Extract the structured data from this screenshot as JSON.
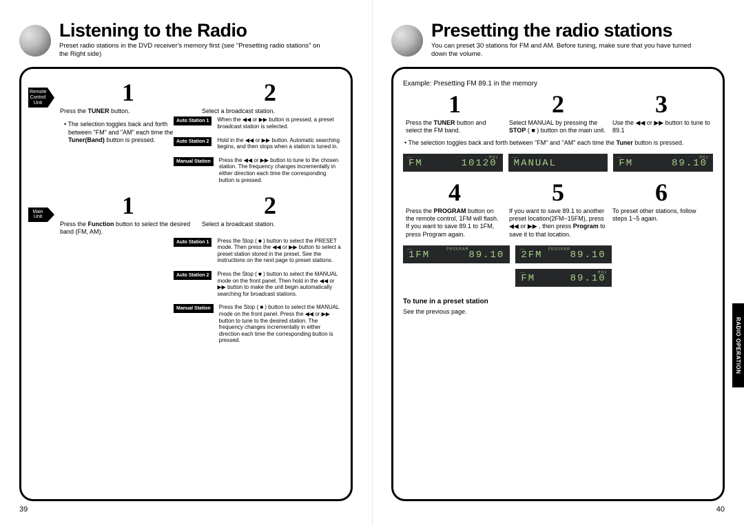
{
  "left": {
    "title": "Listening to the Radio",
    "intro": "Preset radio stations in the DVD receiver's memory first (see \"Presetting radio stations\" on the Right side)",
    "remoteLabel": "Remote Control Unit",
    "mainLabel": "Main Unit",
    "remote": {
      "step1_num": "1",
      "step1_text_a": "Press the ",
      "step1_text_b": "TUNER",
      "step1_text_c": " button.",
      "step2_num": "2",
      "step2_text": "Select a broadcast station.",
      "bullet_a": "• The selection toggles back and forth between \"FM\" and \"AM\" each time the ",
      "bullet_b": "Tuner(Band)",
      "bullet_c": " button is pressed.",
      "rows": [
        {
          "pill": "Auto Station 1",
          "text": "When the ◀◀ or ▶▶ button is pressed, a preset broadcast station is selected."
        },
        {
          "pill": "Auto Station 2",
          "text": "Hold in the ◀◀ or ▶▶ button. Automatic searching begins, and then stops when a station is tuned in."
        },
        {
          "pill": "Manual Station",
          "text": "Press the ◀◀ or ▶▶ button to tune to the chosen station. The frequency changes incrementally in either direction each time the corresponding button is pressed."
        }
      ]
    },
    "main": {
      "step1_num": "1",
      "step1_text_a": "Press the ",
      "step1_text_b": "Function",
      "step1_text_c": " button to select the desired band (FM, AM).",
      "step2_num": "2",
      "step2_text": "Select a broadcast station.",
      "rows": [
        {
          "pill": "Auto Station 1",
          "text": "Press the Stop ( ■ ) button to select the PRESET mode. Then press the ◀◀ or ▶▶ button to select a preset station stored in the preset. See the instructions on the next page to preset stations."
        },
        {
          "pill": "Auto Station 2",
          "text": "Press the Stop ( ■ ) button to select the MANUAL mode on the front panel. Then hold in the ◀◀ or ▶▶ button to make the unit begin automatically searching for broadcast stations."
        },
        {
          "pill": "Manual Station",
          "text": "Press the Stop ( ■ ) button to select the MANUAL mode on the front panel. Press the ◀◀ or ▶▶ button to tune to the desired station. The frequency changes incrementally in either direction each time the corresponding button is pressed."
        }
      ]
    },
    "pageNum": "39"
  },
  "right": {
    "title": "Presetting the radio stations",
    "intro": "You can preset 30 stations for FM and AM. Before tuning, make sure that you have turned down the volume.",
    "example": "Example: Presetting FM 89.1 in the memory",
    "steps": {
      "s1": {
        "num": "1",
        "a": "Press the ",
        "b": "TUNER",
        "c": " button and select the FM band."
      },
      "s2": {
        "num": "2",
        "a": "Select MANUAL by pressing the ",
        "b": "STOP",
        "c": " ( ■ ) button on the main unit."
      },
      "s3": {
        "num": "3",
        "a": "Use the ◀◀ or ▶▶ button to tune to 89.1"
      },
      "s4": {
        "num": "4",
        "a": "Press the ",
        "b": "PROGRAM",
        "c": " button on the remote control, 1FM will flash. If you want to save 89.1 to 1FM, press Program again."
      },
      "s5": {
        "num": "5",
        "a": "If you want to save 89.1 to another preset location(2FM~15FM), press ◀◀ or ▶▶ , then press ",
        "b": "Program",
        "c": " to save it to that location."
      },
      "s6": {
        "num": "6",
        "a": "To preset other stations, follow steps 1~5 again."
      }
    },
    "bullet_a": "• The selection toggles back and forth between \"FM\" and \"AM\" each time the ",
    "bullet_b": "Tuner",
    "bullet_c": " button is pressed.",
    "displays": {
      "d1_l": "FM",
      "d1_r": "10120",
      "d2": "MANUAL",
      "d3_l": "FM",
      "d3_r": "89.10",
      "d4_l": "1FM",
      "d4_r": "89.10",
      "d5_l": "2FM",
      "d5_r": "89.10",
      "d6_l": "FM",
      "d6_r": "89.10",
      "tiny_prog": "PROGRAM",
      "tiny_mhz": "MHz"
    },
    "tuneHdr": "To tune in a preset station",
    "tuneTxt": "See the previous page.",
    "sideTab": "RADIO OPERATION",
    "pageNum": "40"
  }
}
